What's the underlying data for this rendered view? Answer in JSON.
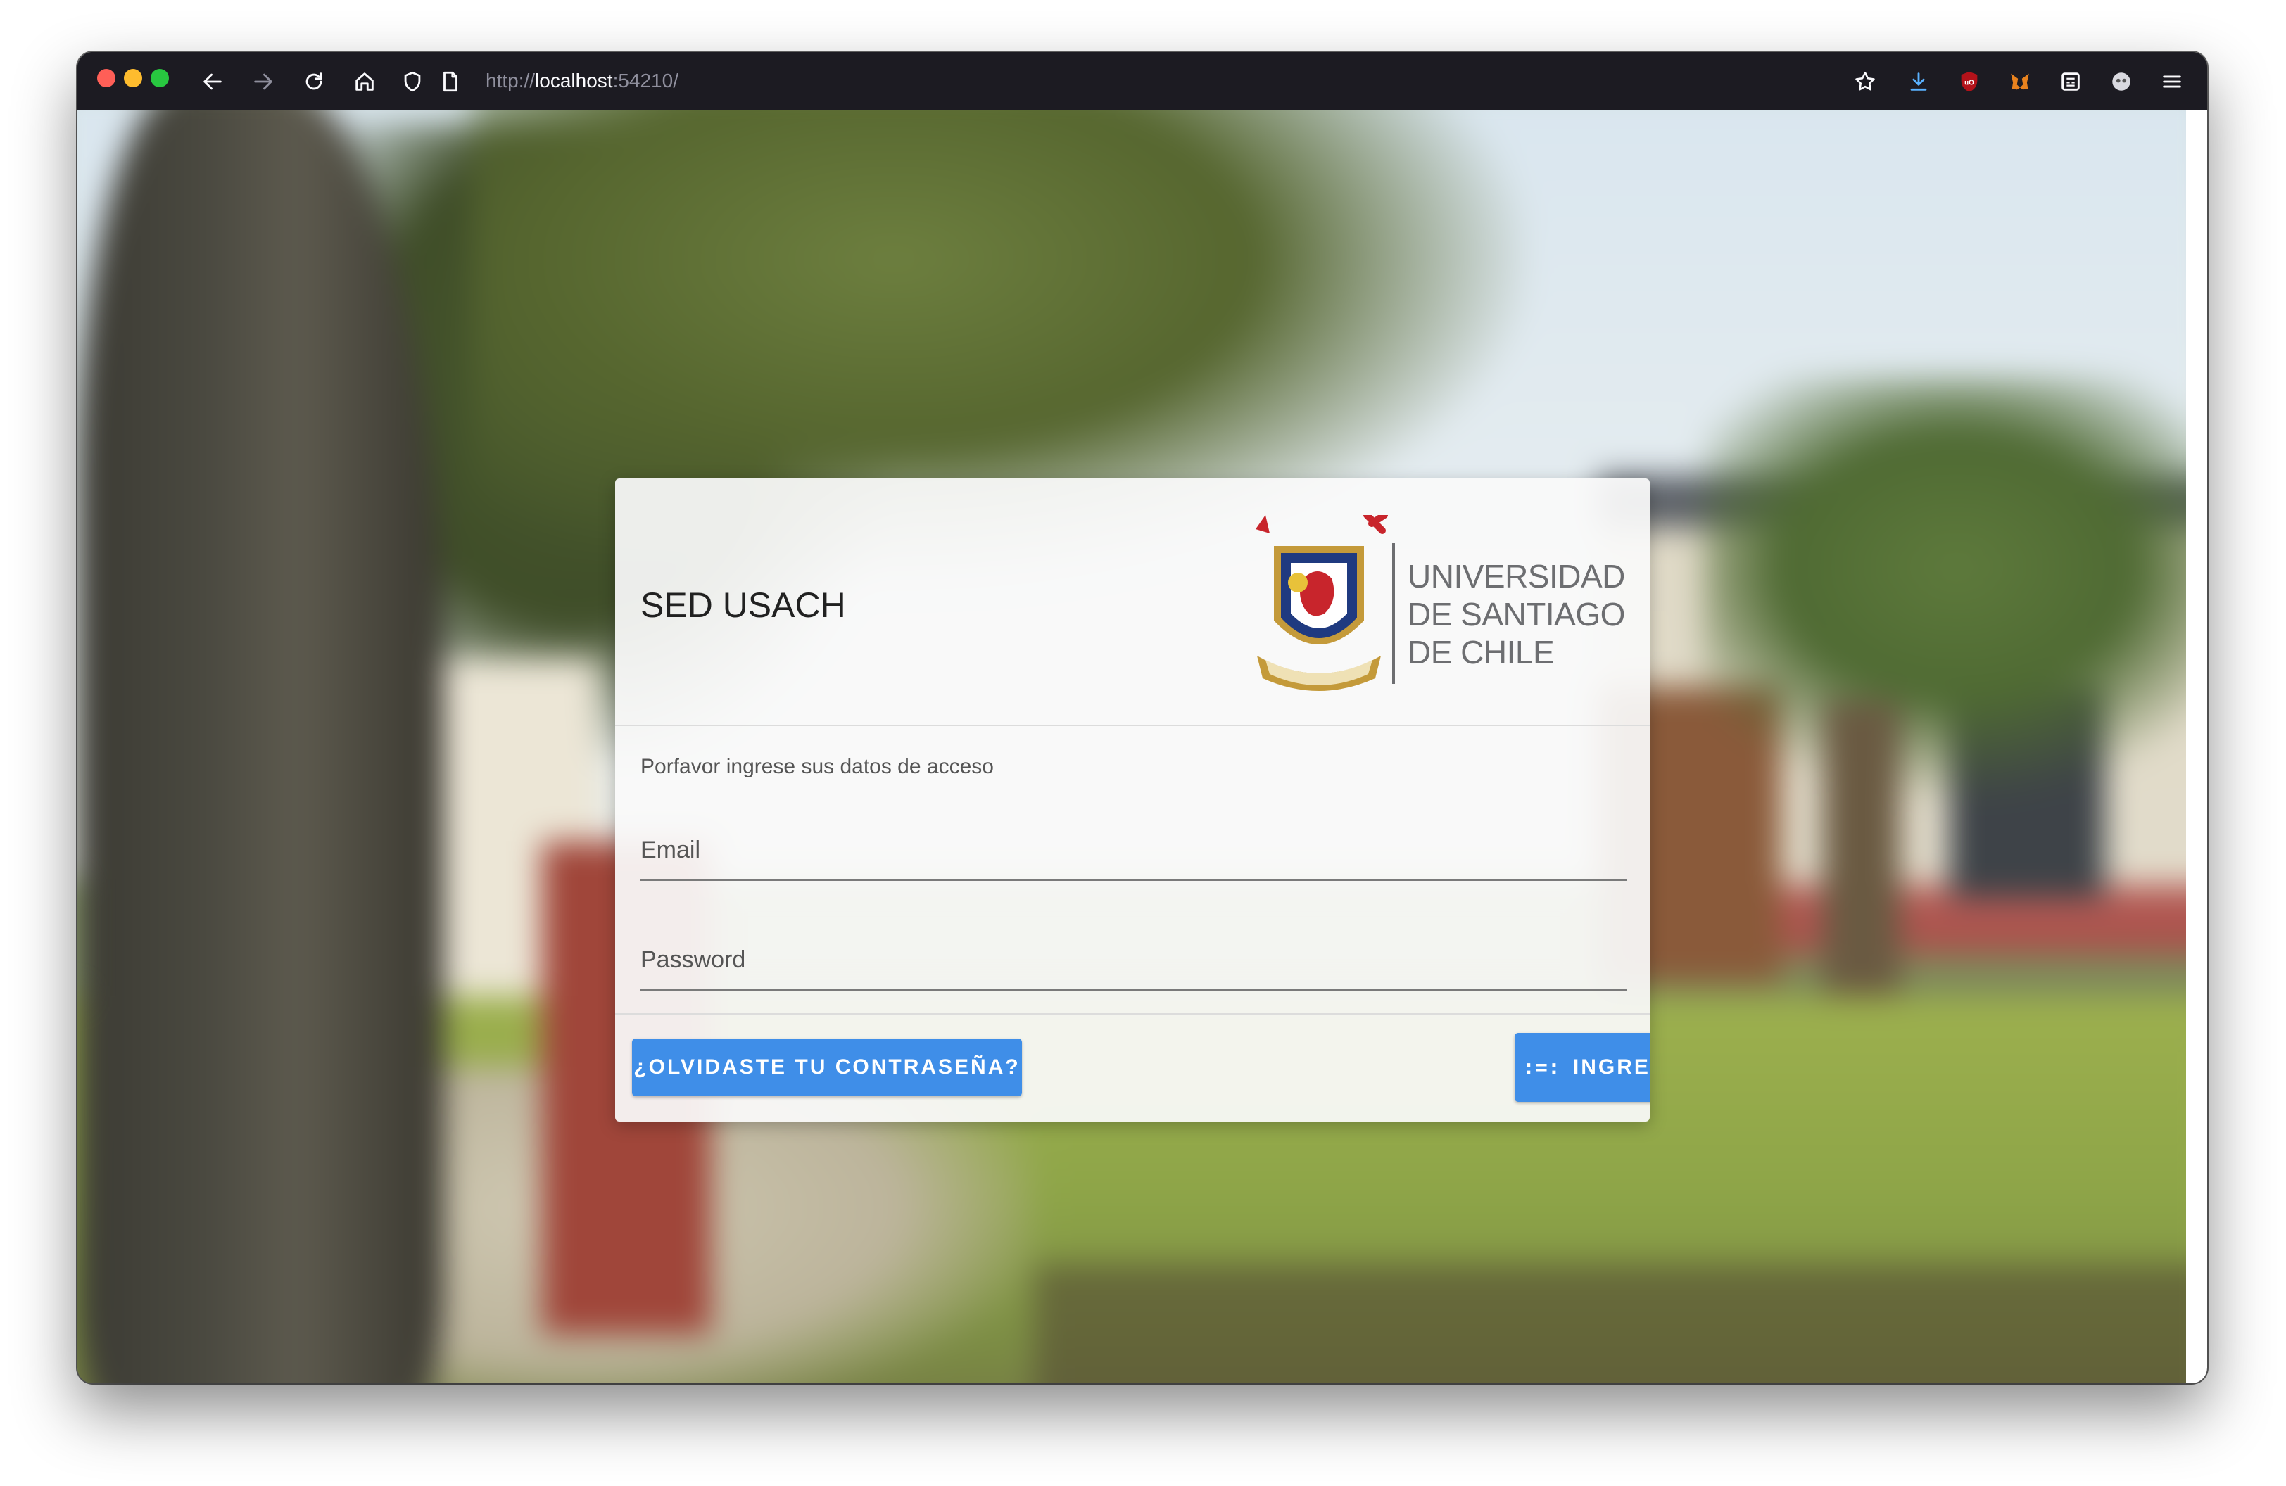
{
  "browser": {
    "url_scheme": "http://",
    "url_host": "localhost",
    "url_port_path": ":54210/",
    "icons": {
      "back": "arrow-left-icon",
      "forward": "arrow-right-icon",
      "reload": "reload-icon",
      "home": "home-icon",
      "shield": "shield-icon",
      "page": "page-icon",
      "bookmark": "star-icon",
      "downloads": "download-icon",
      "extensions": [
        "ublock-icon",
        "metamask-icon",
        "reader-icon",
        "profile-icon"
      ],
      "menu": "hamburger-menu-icon"
    }
  },
  "login": {
    "title": "SED USACH",
    "logo_lines": [
      "UNIVERSIDAD",
      "DE SANTIAGO",
      "DE CHILE"
    ],
    "subtitle": "Porfavor ingrese sus datos de acceso",
    "email_label": "Email",
    "password_label": "Password",
    "forgot_button": "¿OLVIDASTE TU CONTRASEÑA?",
    "login_button": "INGRESAR",
    "login_button_icon": ":=:"
  },
  "colors": {
    "primary_button": "#3f8ee8",
    "toolbar": "#1c1b22"
  }
}
